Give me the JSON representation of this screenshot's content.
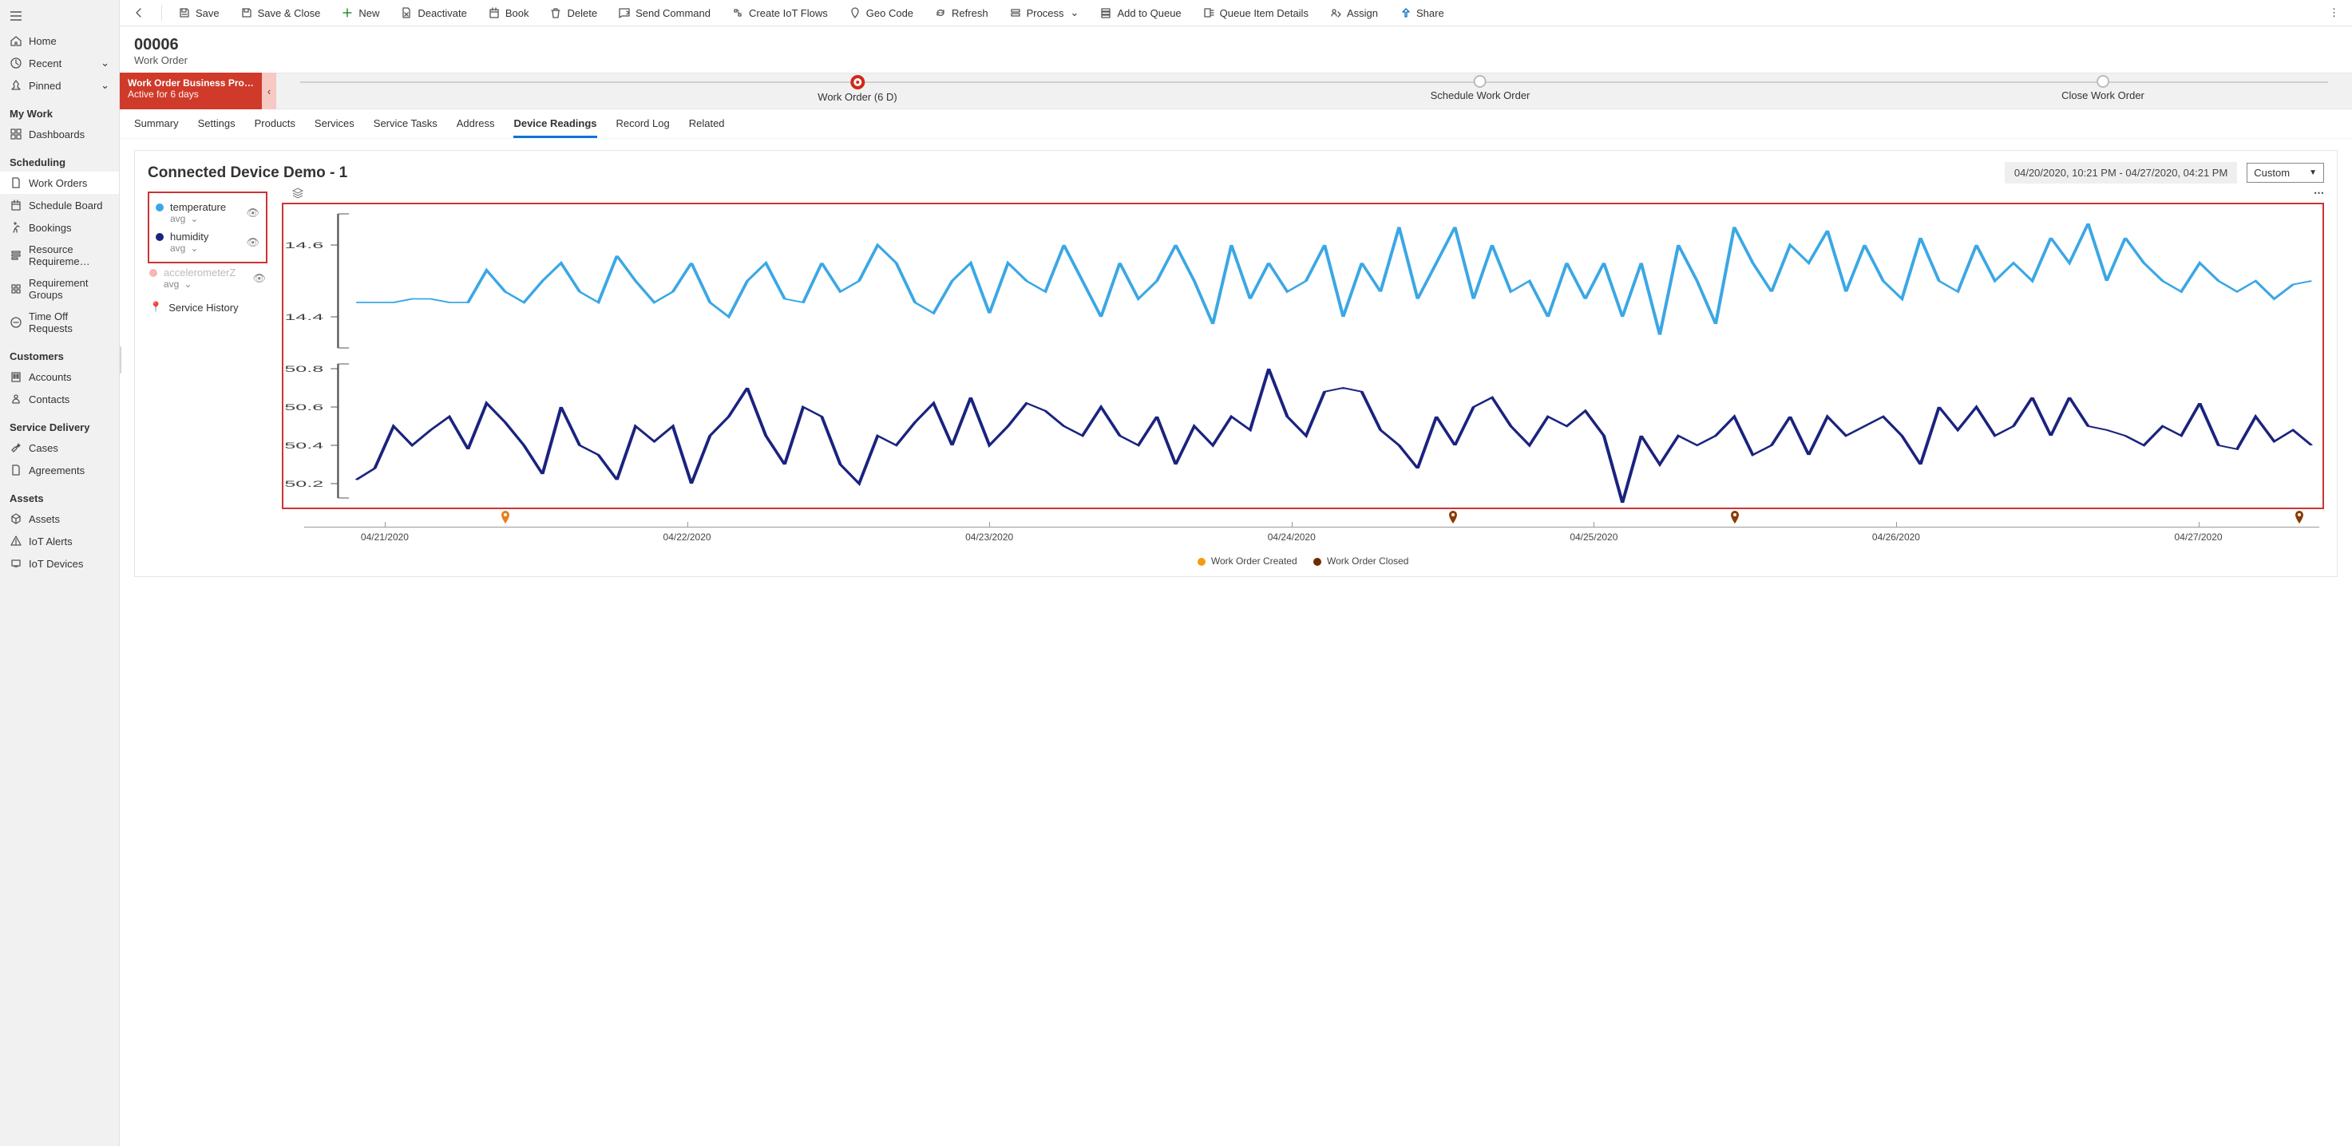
{
  "sidebar": {
    "top": [
      {
        "icon": "home",
        "label": "Home"
      },
      {
        "icon": "clock",
        "label": "Recent",
        "chev": true
      },
      {
        "icon": "pin",
        "label": "Pinned",
        "chev": true
      }
    ],
    "groups": [
      {
        "title": "My Work",
        "items": [
          {
            "icon": "grid",
            "label": "Dashboards"
          }
        ]
      },
      {
        "title": "Scheduling",
        "items": [
          {
            "icon": "doc",
            "label": "Work Orders",
            "selected": true
          },
          {
            "icon": "calendar",
            "label": "Schedule Board"
          },
          {
            "icon": "run",
            "label": "Bookings"
          },
          {
            "icon": "req",
            "label": "Resource Requireme…"
          },
          {
            "icon": "reqg",
            "label": "Requirement Groups"
          },
          {
            "icon": "clockoff",
            "label": "Time Off Requests"
          }
        ]
      },
      {
        "title": "Customers",
        "items": [
          {
            "icon": "building",
            "label": "Accounts"
          },
          {
            "icon": "person",
            "label": "Contacts"
          }
        ]
      },
      {
        "title": "Service Delivery",
        "items": [
          {
            "icon": "wrench",
            "label": "Cases"
          },
          {
            "icon": "doc",
            "label": "Agreements"
          }
        ]
      },
      {
        "title": "Assets",
        "items": [
          {
            "icon": "cube",
            "label": "Assets"
          },
          {
            "icon": "alert",
            "label": "IoT Alerts"
          },
          {
            "icon": "device",
            "label": "IoT Devices"
          }
        ]
      }
    ]
  },
  "commandbar": {
    "items": [
      {
        "id": "back",
        "icon": "back",
        "label": ""
      },
      {
        "id": "save",
        "icon": "save",
        "label": "Save"
      },
      {
        "id": "saveclose",
        "icon": "saveclose",
        "label": "Save & Close"
      },
      {
        "id": "new",
        "icon": "plus",
        "label": "New",
        "green": true
      },
      {
        "id": "deactivate",
        "icon": "deactivate",
        "label": "Deactivate"
      },
      {
        "id": "book",
        "icon": "calendar",
        "label": "Book"
      },
      {
        "id": "delete",
        "icon": "trash",
        "label": "Delete"
      },
      {
        "id": "sendcmd",
        "icon": "send",
        "label": "Send Command"
      },
      {
        "id": "createiot",
        "icon": "flow",
        "label": "Create IoT Flows"
      },
      {
        "id": "geocode",
        "icon": "geo",
        "label": "Geo Code"
      },
      {
        "id": "refresh",
        "icon": "refresh",
        "label": "Refresh"
      },
      {
        "id": "process",
        "icon": "process",
        "label": "Process",
        "chev": true
      },
      {
        "id": "addqueue",
        "icon": "queue",
        "label": "Add to Queue"
      },
      {
        "id": "queueitem",
        "icon": "queuedetails",
        "label": "Queue Item Details"
      },
      {
        "id": "assign",
        "icon": "assign",
        "label": "Assign"
      },
      {
        "id": "share",
        "icon": "share",
        "label": "Share"
      }
    ]
  },
  "record": {
    "title": "00006",
    "subtitle": "Work Order"
  },
  "bpf": {
    "title": "Work Order Business Pro…",
    "subtitle": "Active for 6 days",
    "stages": [
      {
        "label": "Work Order  (6 D)",
        "active": true,
        "pos": 28
      },
      {
        "label": "Schedule Work Order",
        "pos": 58
      },
      {
        "label": "Close Work Order",
        "pos": 88
      }
    ]
  },
  "tabs": [
    {
      "label": "Summary"
    },
    {
      "label": "Settings"
    },
    {
      "label": "Products"
    },
    {
      "label": "Services"
    },
    {
      "label": "Service Tasks"
    },
    {
      "label": "Address"
    },
    {
      "label": "Device Readings",
      "active": true
    },
    {
      "label": "Record Log"
    },
    {
      "label": "Related"
    }
  ],
  "card": {
    "title": "Connected Device Demo - 1",
    "date_range": "04/20/2020, 10:21 PM - 04/27/2020, 04:21 PM",
    "range_mode": "Custom"
  },
  "legend": {
    "series": [
      {
        "name": "temperature",
        "agg": "avg",
        "color": "#3ba7e5"
      },
      {
        "name": "humidity",
        "agg": "avg",
        "color": "#1a237e"
      },
      {
        "name": "accelerometerZ",
        "agg": "avg",
        "color": "#f5b7b1",
        "disabled": true
      }
    ],
    "service_history_label": "Service History"
  },
  "event_legend": {
    "created": {
      "label": "Work Order Created",
      "color": "#f39c12"
    },
    "closed": {
      "label": "Work Order Closed",
      "color": "#6e2c00"
    }
  },
  "chart_data": [
    {
      "type": "line",
      "title": "temperature",
      "ylabel": "",
      "ylim": [
        14.3,
        14.7
      ],
      "yticks": [
        14.4,
        14.6
      ],
      "color": "#3ba7e5",
      "x_start": "04/20/2020 22:21",
      "x_end": "04/27/2020 16:21",
      "values": [
        14.44,
        14.44,
        14.44,
        14.45,
        14.45,
        14.44,
        14.44,
        14.53,
        14.47,
        14.44,
        14.5,
        14.55,
        14.47,
        14.44,
        14.57,
        14.5,
        14.44,
        14.47,
        14.55,
        14.44,
        14.4,
        14.5,
        14.55,
        14.45,
        14.44,
        14.55,
        14.47,
        14.5,
        14.6,
        14.55,
        14.44,
        14.41,
        14.5,
        14.55,
        14.41,
        14.55,
        14.5,
        14.47,
        14.6,
        14.5,
        14.4,
        14.55,
        14.45,
        14.5,
        14.6,
        14.5,
        14.38,
        14.6,
        14.45,
        14.55,
        14.47,
        14.5,
        14.6,
        14.4,
        14.55,
        14.47,
        14.65,
        14.45,
        14.55,
        14.65,
        14.45,
        14.6,
        14.47,
        14.5,
        14.4,
        14.55,
        14.45,
        14.55,
        14.4,
        14.55,
        14.35,
        14.6,
        14.5,
        14.38,
        14.65,
        14.55,
        14.47,
        14.6,
        14.55,
        14.64,
        14.47,
        14.6,
        14.5,
        14.45,
        14.62,
        14.5,
        14.47,
        14.6,
        14.5,
        14.55,
        14.5,
        14.62,
        14.55,
        14.66,
        14.5,
        14.62,
        14.55,
        14.5,
        14.47,
        14.55,
        14.5,
        14.47,
        14.5,
        14.45,
        14.49,
        14.5
      ]
    },
    {
      "type": "line",
      "title": "humidity",
      "ylabel": "",
      "ylim": [
        50.1,
        50.85
      ],
      "yticks": [
        50.2,
        50.4,
        50.6,
        50.8
      ],
      "color": "#1a237e",
      "x_start": "04/20/2020 22:21",
      "x_end": "04/27/2020 16:21",
      "values": [
        50.22,
        50.28,
        50.5,
        50.4,
        50.48,
        50.55,
        50.38,
        50.62,
        50.52,
        50.4,
        50.25,
        50.6,
        50.4,
        50.35,
        50.22,
        50.5,
        50.42,
        50.5,
        50.2,
        50.45,
        50.55,
        50.7,
        50.45,
        50.3,
        50.6,
        50.55,
        50.3,
        50.2,
        50.45,
        50.4,
        50.52,
        50.62,
        50.4,
        50.65,
        50.4,
        50.5,
        50.62,
        50.58,
        50.5,
        50.45,
        50.6,
        50.45,
        50.4,
        50.55,
        50.3,
        50.5,
        50.4,
        50.55,
        50.48,
        50.8,
        50.55,
        50.45,
        50.68,
        50.7,
        50.68,
        50.48,
        50.4,
        50.28,
        50.55,
        50.4,
        50.6,
        50.65,
        50.5,
        50.4,
        50.55,
        50.5,
        50.58,
        50.45,
        50.1,
        50.45,
        50.3,
        50.45,
        50.4,
        50.45,
        50.55,
        50.35,
        50.4,
        50.55,
        50.35,
        50.55,
        50.45,
        50.5,
        50.55,
        50.45,
        50.3,
        50.6,
        50.48,
        50.6,
        50.45,
        50.5,
        50.65,
        50.45,
        50.65,
        50.5,
        50.48,
        50.45,
        50.4,
        50.5,
        50.45,
        50.62,
        50.4,
        50.38,
        50.55,
        50.42,
        50.48,
        50.4
      ]
    }
  ],
  "x_axis": {
    "ticks": [
      {
        "label": "04/21/2020",
        "pct": 4
      },
      {
        "label": "04/22/2020",
        "pct": 19
      },
      {
        "label": "04/23/2020",
        "pct": 34
      },
      {
        "label": "04/24/2020",
        "pct": 49
      },
      {
        "label": "04/25/2020",
        "pct": 64
      },
      {
        "label": "04/26/2020",
        "pct": 79
      },
      {
        "label": "04/27/2020",
        "pct": 94
      }
    ],
    "pins": [
      {
        "pct": 10,
        "color": "orange"
      },
      {
        "pct": 57,
        "color": "brown"
      },
      {
        "pct": 71,
        "color": "brown"
      },
      {
        "pct": 99,
        "color": "brown"
      }
    ]
  }
}
